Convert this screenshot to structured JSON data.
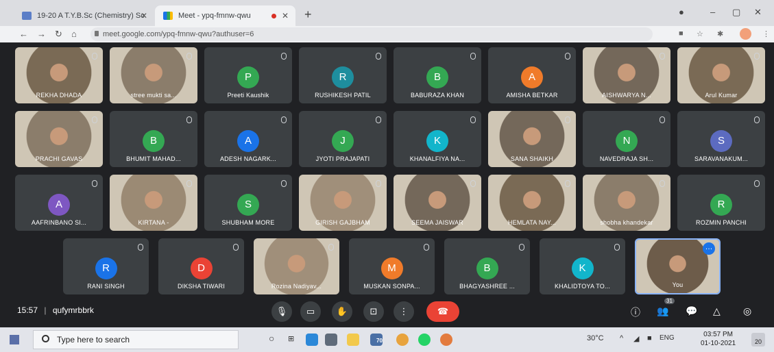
{
  "browser": {
    "tabs": [
      {
        "label": "19-20 A T.Y.B.Sc (Chemistry) Sc",
        "active": false
      },
      {
        "label": "Meet - ypq-fmnw-qwu",
        "active": true
      }
    ],
    "url": "meet.google.com/ypq-fmnw-qwu?authuser=6"
  },
  "meet": {
    "time": "15:57",
    "separator": "|",
    "code": "qufymrbbrk",
    "participants": [
      {
        "name": "REKHA DHADA",
        "initial": "",
        "video": true
      },
      {
        "name": "stree mukti sa...",
        "initial": "",
        "video": true
      },
      {
        "name": "Preeti Kaushik",
        "initial": "P",
        "color": "#34a853"
      },
      {
        "name": "RUSHIKESH PATIL",
        "initial": "R",
        "color": "#1e8e9e"
      },
      {
        "name": "BABURAZA KHAN",
        "initial": "B",
        "color": "#34a853"
      },
      {
        "name": "AMISHA BETKAR",
        "initial": "A",
        "color": "#f07b2a"
      },
      {
        "name": "AISHWARYA N...",
        "initial": "",
        "video": true
      },
      {
        "name": "Arul Kumar",
        "initial": "",
        "video": true
      },
      {
        "name": "PRACHI GAVAS",
        "initial": "",
        "video": true
      },
      {
        "name": "BHUMIT MAHAD...",
        "initial": "B",
        "color": "#34a853"
      },
      {
        "name": "ADESH NAGARK...",
        "initial": "A",
        "color": "#1a73e8"
      },
      {
        "name": "JYOTI PRAJAPATI",
        "initial": "J",
        "color": "#34a853"
      },
      {
        "name": "KHANALFIYA NA...",
        "initial": "K",
        "color": "#12b5cb"
      },
      {
        "name": "SANA SHAIKH",
        "initial": "",
        "video": true
      },
      {
        "name": "NAVEDRAJA SH...",
        "initial": "N",
        "color": "#34a853"
      },
      {
        "name": "SARAVANAKUM...",
        "initial": "S",
        "color": "#5c6bc0"
      },
      {
        "name": "AAFRINBANO SI...",
        "initial": "A",
        "color": "#7e57c2"
      },
      {
        "name": "KIRTANA -",
        "initial": "",
        "video": true
      },
      {
        "name": "SHUBHAM MORE",
        "initial": "S",
        "color": "#34a853"
      },
      {
        "name": "GIRISH GAJBHAM",
        "initial": "",
        "video": true
      },
      {
        "name": "SEEMA JAISWAR",
        "initial": "",
        "video": true
      },
      {
        "name": "HEMLATA NAY...",
        "initial": "",
        "video": true
      },
      {
        "name": "shobha khandekar",
        "initial": "",
        "video": true
      },
      {
        "name": "ROZMIN PANCHI",
        "initial": "R",
        "color": "#34a853"
      },
      {
        "name": "RANI SINGH",
        "initial": "R",
        "color": "#1a73e8"
      },
      {
        "name": "DIKSHA TIWARI",
        "initial": "D",
        "color": "#ea4335"
      },
      {
        "name": "Rozina Nadiyav...",
        "initial": "",
        "video": true
      },
      {
        "name": "MUSKAN SONPA...",
        "initial": "M",
        "color": "#f07b2a"
      },
      {
        "name": "BHAGYASHREE ...",
        "initial": "B",
        "color": "#34a853"
      },
      {
        "name": "KHALIDTOYA TO...",
        "initial": "K",
        "color": "#12b5cb"
      },
      {
        "name": "You",
        "initial": "",
        "video": true,
        "self": true
      }
    ],
    "people_count": "31"
  },
  "taskbar": {
    "search_placeholder": "Type here to search",
    "weather": "30°C",
    "lang": "ENG",
    "time": "03:57 PM",
    "date": "01-10-2021",
    "notifications": "20",
    "app_badge": "70"
  }
}
